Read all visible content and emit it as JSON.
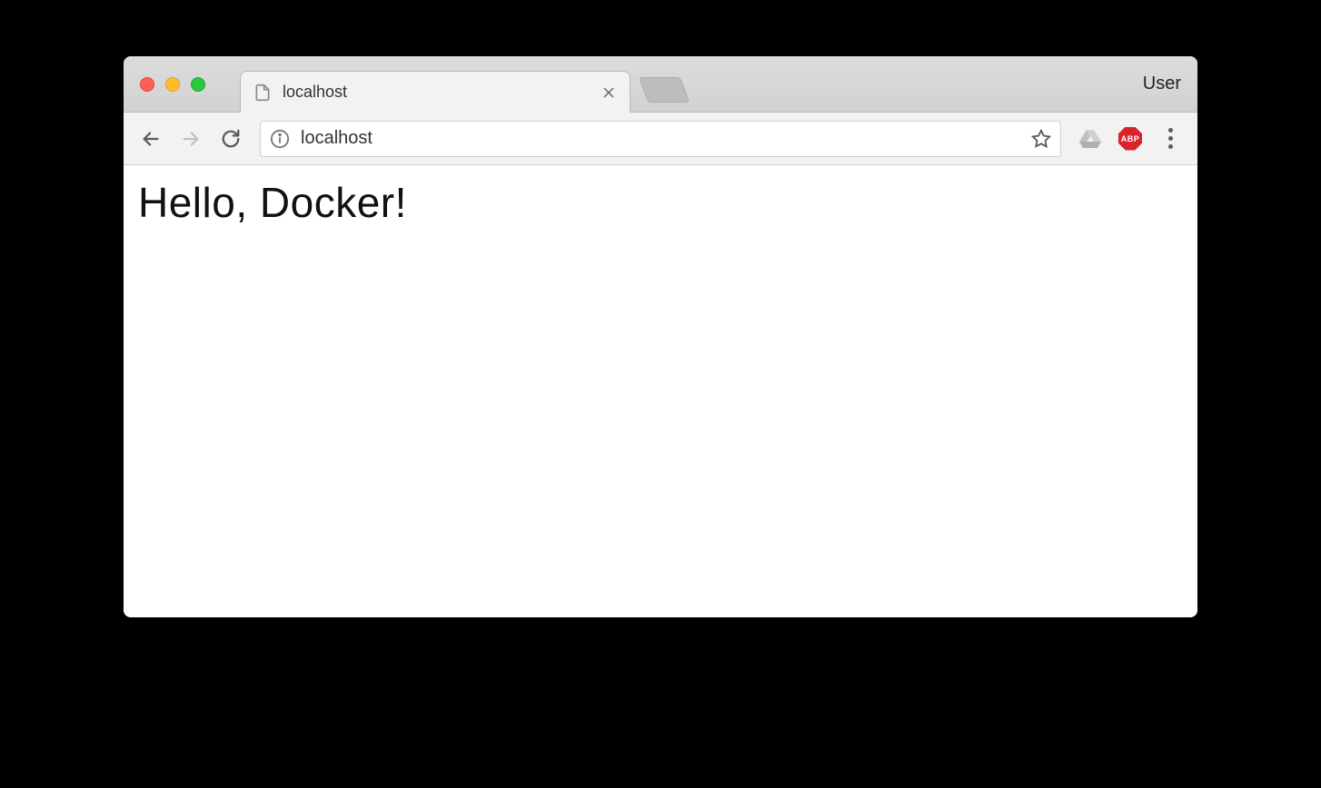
{
  "window": {
    "profile_label": "User"
  },
  "tab": {
    "title": "localhost"
  },
  "address_bar": {
    "url": "localhost"
  },
  "extensions": {
    "abp_label": "ABP"
  },
  "page": {
    "heading": "Hello, Docker!"
  }
}
